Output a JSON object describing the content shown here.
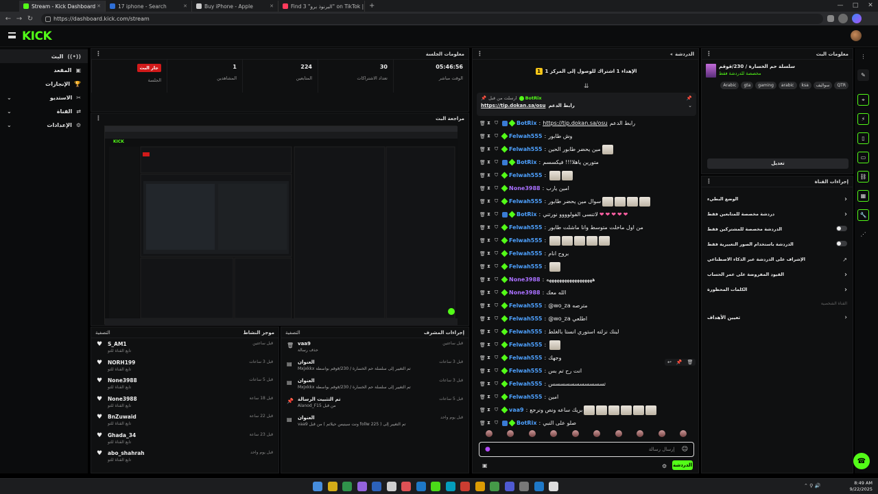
{
  "browser": {
    "tabs": [
      {
        "label": "Stream - Kick Dashboard",
        "color": "#53fc18"
      },
      {
        "label": "17 iphone - Search",
        "color": "#2f6fd6"
      },
      {
        "label": "Buy iPhone - Apple",
        "color": "#cccccc"
      },
      {
        "label": "Find 3 \"البرنوذ برو\" on TikTok | TikTo",
        "color": "#ff3b5c"
      }
    ],
    "new_tab": "+",
    "url": "https://dashboard.kick.com/stream",
    "win_controls": [
      "—",
      "□",
      "✕"
    ]
  },
  "header": {
    "logo": "KICK"
  },
  "nav": {
    "items": [
      {
        "label": "البث",
        "icon": "((•))"
      },
      {
        "label": "المقعد",
        "icon": "▣"
      },
      {
        "label": "الإنجازات",
        "icon": "🏆"
      },
      {
        "label": "الاستديو",
        "icon": "✂"
      },
      {
        "label": "القناة",
        "icon": "⇄"
      },
      {
        "label": "الإعدادات",
        "icon": "⚙"
      }
    ]
  },
  "session": {
    "title": "معلومات الجلسة",
    "stats": [
      {
        "value": "05:46:56",
        "label": "الوقت مباشر"
      },
      {
        "value": "30",
        "label": "تعداد الاشتراكات"
      },
      {
        "value": "224",
        "label": "المتابعين"
      },
      {
        "value": "1",
        "label": "المشاهدين"
      },
      {
        "value": "جار البث",
        "label": "الجلسة"
      }
    ]
  },
  "preview": {
    "title": "مراجعة البث"
  },
  "activity": {
    "title": "موجز النشاط",
    "filter": "التصفية",
    "rows": [
      {
        "name": "S_AM1",
        "sub": "تابع القناة للتو",
        "time": "قبل ساعتين"
      },
      {
        "name": "NORH199",
        "sub": "تابع القناة للتو",
        "time": "قبل 3 ساعات"
      },
      {
        "name": "None3988",
        "sub": "تابع القناة للتو",
        "time": "قبل 5 ساعات"
      },
      {
        "name": "None3988",
        "sub": "تابع القناة للتو",
        "time": "قبل 18 ساعة"
      },
      {
        "name": "BnZuwaid",
        "sub": "تابع القناة للتو",
        "time": "قبل 22 ساعة"
      },
      {
        "name": "Ghada_34",
        "sub": "تابع القناة للتو",
        "time": "قبل 23 ساعة"
      },
      {
        "name": "abo_shahrah",
        "sub": "تابع القناة للتو",
        "time": "قبل يوم واحد"
      }
    ]
  },
  "modactions": {
    "title": "إجراءات المشرف",
    "filter": "التصفية",
    "rows": [
      {
        "title": "vaa9",
        "sub": "حذف رسالة",
        "time": "قبل ساعتين",
        "icon": "🗑"
      },
      {
        "title": "العنوان",
        "sub": "تم التغيير إلى سلسلة حم الخسارة / 230/قوقم بواسطة Mxjxkkx",
        "time": "قبل 3 ساعات",
        "icon": "▤"
      },
      {
        "title": "العنوان",
        "sub": "تم التغيير إلى سلسلة حم الخسارة / 230/قوقم بواسطة Mxjxkkx",
        "time": "قبل 3 ساعات",
        "icon": "▤"
      },
      {
        "title": "تم التثبيت الرسالة",
        "sub": "من قبل Alanod_F15",
        "time": "قبل 5 ساعات",
        "icon": "📌"
      },
      {
        "title": "العنوان",
        "sub": "تم التغيير إلى ( 225 follw ونت سينيس حيلاتم ) من قبل vaa9",
        "time": "قبل يوم واحد",
        "icon": "▤"
      }
    ]
  },
  "chat": {
    "title": "الدردشة",
    "goal": "الإهداء 1 اشتراك للوصول إلى المركز 1",
    "pinned": {
      "user": "BotRix",
      "by": "ارسلت من قبل",
      "text": "رابط الدعم",
      "link": "https://tip.dokan.sa/osu"
    },
    "input_placeholder": "إرسال رسالة",
    "send_label": "الدردشة",
    "messages": [
      {
        "user": "BotRix",
        "color": "b",
        "bot": true,
        "text": "رابط الدعم",
        "link": "https://tip.dokan.sa/osu",
        "emotes": 0,
        "hearts": 0
      },
      {
        "user": "Felwah555",
        "color": "b",
        "text": "وش طابور",
        "emotes": 0,
        "hearts": 0
      },
      {
        "user": "Felwah555",
        "color": "b",
        "text": "مين يحضر طابور الحين",
        "emotes": 1,
        "hearts": 0
      },
      {
        "user": "BotRix",
        "color": "b",
        "bot": true,
        "text": "متورين ياهلا!!! فيكسسم",
        "emotes": 0,
        "hearts": 0
      },
      {
        "user": "Felwah555",
        "color": "b",
        "text": "",
        "emotes": 2,
        "hearts": 0
      },
      {
        "user": "None3988",
        "color": "p",
        "text": "امين يارب",
        "emotes": 0,
        "hearts": 0
      },
      {
        "user": "Felwah555",
        "color": "b",
        "text": "سوال مين يحضر طابور",
        "emotes": 4,
        "hearts": 0
      },
      {
        "user": "BotRix",
        "color": "b",
        "bot": true,
        "text": "لاتنسى الفولوووو نورتني",
        "emotes": 0,
        "hearts": 5
      },
      {
        "user": "Felwah555",
        "color": "b",
        "text": "من اول ماخلت متوسط وانا ماشلت طابور",
        "emotes": 0,
        "hearts": 0
      },
      {
        "user": "Felwah555",
        "color": "b",
        "text": "",
        "emotes": 5,
        "hearts": 0
      },
      {
        "user": "Felwah555",
        "color": "b",
        "text": "بروح انام",
        "emotes": 0,
        "hearts": 0
      },
      {
        "user": "Felwah555",
        "color": "b",
        "text": "",
        "emotes": 1,
        "hearts": 0
      },
      {
        "user": "None3988",
        "color": "p",
        "text": "ههههههههههههههههههه",
        "emotes": 0,
        "hearts": 0
      },
      {
        "user": "None3988",
        "color": "p",
        "text": "الله معك",
        "emotes": 0,
        "hearts": 0
      },
      {
        "user": "Felwah555",
        "color": "b",
        "text": "@wo_za مترصه",
        "emotes": 0,
        "hearts": 0
      },
      {
        "user": "Felwah555",
        "color": "b",
        "text": "@wo_za اطلعي",
        "emotes": 0,
        "hearts": 0
      },
      {
        "user": "Felwah555",
        "color": "b",
        "text": "لبنك نزلته استوري انستا بالغلط",
        "emotes": 0,
        "hearts": 0
      },
      {
        "user": "Felwah555",
        "color": "b",
        "text": "",
        "emotes": 1,
        "hearts": 0
      },
      {
        "user": "Felwah555",
        "color": "b",
        "text": "وجهك",
        "emotes": 0,
        "hearts": 0
      },
      {
        "user": "Felwah555",
        "color": "b",
        "text": "انت رح تم بس",
        "emotes": 0,
        "hearts": 0
      },
      {
        "user": "Felwah555",
        "color": "b",
        "text": "تسسسسسسسسسسس",
        "emotes": 0,
        "hearts": 0
      },
      {
        "user": "Felwah555",
        "color": "b",
        "text": "امين",
        "emotes": 0,
        "hearts": 0
      },
      {
        "user": "vaa9",
        "color": "b",
        "text": "بريك ساعه ونص ونرجع",
        "emotes": 6,
        "hearts": 0
      },
      {
        "user": "BotRix",
        "color": "b",
        "bot": true,
        "text": "صلو على النبي",
        "emotes": 0,
        "hearts": 0
      }
    ]
  },
  "streaminfo": {
    "title": "معلومات البث",
    "stream_title": "سلسلة حم الخسارة / 230/قوقم",
    "category": "مخصصة للدردشة فقط",
    "tags": [
      "QTR",
      "سواليف",
      "ksa",
      "arabic",
      "gaming",
      "gta",
      "Arabic"
    ],
    "edit": "تعديل"
  },
  "channelactions": {
    "title": "إجراءات القناة",
    "items": [
      {
        "label": "الوضع البطيء",
        "control": "chevron"
      },
      {
        "label": "دردشة مخصصة للمتابعين فقط",
        "control": "chevron"
      },
      {
        "label": "الدردشة مخصصة للمشتركين فقط",
        "control": "toggle"
      },
      {
        "label": "الدردشة باستخدام الصور التعبيرية فقط",
        "control": "toggle"
      },
      {
        "label": "الإشراف على الدردشة عبر الذكاء الاصطناعي",
        "control": "external"
      },
      {
        "label": "القيود المفروضة على عمر الحساب",
        "control": "chevron"
      },
      {
        "label": "الكلمات المحظورة",
        "control": "chevron"
      }
    ],
    "section": "القناة الشخصية",
    "goals": "تعيين الأهداف"
  },
  "taskbar": {
    "time": "8:49 AM",
    "date": "9/22/2025"
  },
  "colors": {
    "accent": "#53fc18",
    "live": "#d11a1a",
    "purple": "#a970ff",
    "blue": "#4ea1ff"
  }
}
